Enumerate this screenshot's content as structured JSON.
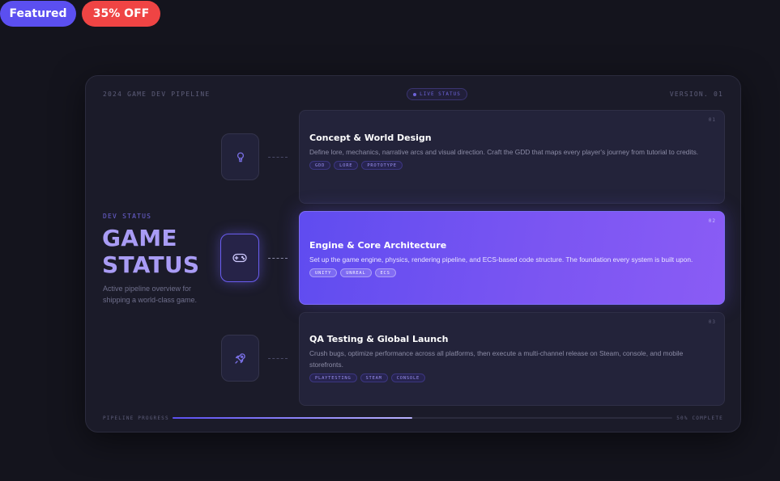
{
  "badges": {
    "featured": "Featured",
    "discount": "35% OFF"
  },
  "header": {
    "left": "2024 GAME DEV PIPELINE",
    "live": "LIVE STATUS",
    "right": "VERSION. 01"
  },
  "hero": {
    "eyebrow": "DEV STATUS",
    "title_line1": "GAME",
    "title_line2": "STATUS",
    "subtitle": "Active pipeline overview for shipping a world-class game."
  },
  "steps": [
    {
      "num": "01",
      "title": "Concept & World Design",
      "desc": "Define lore, mechanics, narrative arcs and visual direction. Craft the GDD that maps every player's journey from tutorial to credits.",
      "tags": [
        "GDD",
        "LORE",
        "PROTOTYPE"
      ],
      "icon": "lightbulb-icon",
      "active": false
    },
    {
      "num": "02",
      "title": "Engine & Core Architecture",
      "desc": "Set up the game engine, physics, rendering pipeline, and ECS-based code structure. The foundation every system is built upon.",
      "tags": [
        "UNITY",
        "UNREAL",
        "ECS"
      ],
      "icon": "gamepad-icon",
      "active": true
    },
    {
      "num": "03",
      "title": "QA Testing & Global Launch",
      "desc": "Crush bugs, optimize performance across all platforms, then execute a multi-channel release on Steam, console, and mobile storefronts.",
      "tags": [
        "PLAYTESTING",
        "STEAM",
        "CONSOLE"
      ],
      "icon": "rocket-icon",
      "active": false
    }
  ],
  "progress": {
    "label": "PIPELINE PROGRESS",
    "value": 0.48,
    "percent_label": "50% COMPLETE"
  },
  "colors": {
    "accent": "#5b4ff0",
    "discount": "#ef4444",
    "background": "#14141d"
  }
}
